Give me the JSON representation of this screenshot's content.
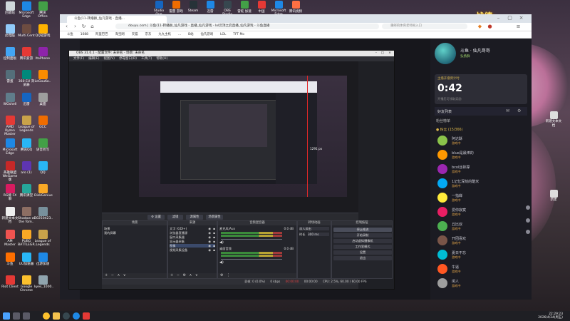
{
  "desktop": {
    "left_icons": [
      {
        "label": "回收站",
        "color": "#cfd8dc"
      },
      {
        "label": "Microsoft Edge",
        "color": "#1e88e5"
      },
      {
        "label": "腾讯 Office",
        "color": "#43a047"
      },
      {
        "label": "此电脑",
        "color": "#90caf9"
      },
      {
        "label": "Multi.Cent",
        "color": "#6d4c41"
      },
      {
        "label": "QQ轻游戏",
        "color": "#ffb300"
      },
      {
        "label": "控制面板",
        "color": "#42a5f5"
      },
      {
        "label": "腾讯爱游",
        "color": "#e53935"
      },
      {
        "label": "ItoPhone",
        "color": "#8e24aa"
      },
      {
        "label": "雷蛋",
        "color": "#546e7a"
      },
      {
        "label": "360 EU 浏览器",
        "color": "#00897b"
      },
      {
        "label": "LeGouKo..",
        "color": "#fb8c00"
      },
      {
        "label": "WGshell",
        "color": "#607d8b"
      },
      {
        "label": "迅雷",
        "color": "#1565c0"
      },
      {
        "label": "桌面",
        "color": "#9e9e9e"
      },
      {
        "label": "AMD Ryzen Master",
        "color": "#e53935"
      },
      {
        "label": "League of Legends",
        "color": "#c9a24a"
      },
      {
        "label": "GCC",
        "color": "#ef6c00"
      },
      {
        "label": "Microsoft Edge",
        "color": "#1e88e5"
      },
      {
        "label": "腾讯QQ",
        "color": "#29b6f6"
      },
      {
        "label": "语音听写",
        "color": "#43a047"
      },
      {
        "label": "英雄联盟 WeGame版",
        "color": "#c62828"
      },
      {
        "label": "aro (1)",
        "color": "#5e35b1"
      },
      {
        "label": "QQ",
        "color": "#29b6f6"
      },
      {
        "label": "RG能 FX 聊",
        "color": "#d81b60"
      },
      {
        "label": "腾讯课堂",
        "color": "#26a69a"
      },
      {
        "label": "DiskGenius",
        "color": "#f9a825"
      },
      {
        "label": "新建文本文档",
        "color": "#eeeeee"
      },
      {
        "label": "Shadow of the Tom..",
        "color": "#8d6e63"
      },
      {
        "label": "20250423..",
        "color": "#78909c"
      },
      {
        "label": "AM Master",
        "color": "#ef5350"
      },
      {
        "label": "PUBG BATTLEGR..",
        "color": "#f9a825"
      },
      {
        "label": "League of Legends",
        "color": "#c9a24a"
      },
      {
        "label": "斗鱼",
        "color": "#ff6f00"
      },
      {
        "label": "UU加速器",
        "color": "#29b6f6"
      },
      {
        "label": "迅游加速",
        "color": "#1e88e5"
      },
      {
        "label": "Riot Client",
        "color": "#e53935"
      },
      {
        "label": "Google Chrome",
        "color": "#fbc02d"
      },
      {
        "label": "kyes_1000..",
        "color": "#90a4ae"
      }
    ],
    "top_icons": [
      {
        "label": "Studio One",
        "color": "#1565c0"
      },
      {
        "label": "雷霆 游戏",
        "color": "#ef6c00"
      },
      {
        "label": "Steam",
        "color": "#263238"
      },
      {
        "label": "迅雷",
        "color": "#1e88e5"
      },
      {
        "label": "OBS Studio",
        "color": "#37474f"
      },
      {
        "label": "雷蛇 加速",
        "color": "#43a047"
      },
      {
        "label": "中国",
        "color": "#e53935"
      },
      {
        "label": "Microsoft Edge",
        "color": "#1e88e5"
      },
      {
        "label": "腾讯视频",
        "color": "#ff7043"
      }
    ],
    "watermark": "战绩:",
    "right_icons": [
      {
        "label": "新建文本文档"
      },
      {
        "label": "新建"
      }
    ]
  },
  "browser": {
    "tab_title": "斗鱼(11-转播群_仙凡游戏 - 直播...",
    "address": "douyu.com | 斗鱼(11-转播群_仙凡游戏 - 直播_仙凡游戏 - lol云顶之弈直播_仙凡游戏 - 斗鱼直播",
    "search_placeholder": "重邮的体育老师闹入口",
    "bookmarks": [
      "斗鱼",
      "1688",
      "阿里巴巴",
      "淘宝网",
      "天猫",
      "京东",
      "九九主机",
      "...",
      "B站",
      "仙凡游戏",
      "LOL",
      "TFT Mo"
    ]
  },
  "stream_page": {
    "streamer_name": "斗鱼 · 仙凡哥哥",
    "room_tag": "弘扬群",
    "countdown_label": "主播开播倒计时",
    "countdown": "0:42",
    "countdown_sub": "开播后可领取奖励",
    "fans_title": "好友列表",
    "fans_section": "粉丝榜单",
    "fans_group": "● 粉丝 (15/366)",
    "fans": [
      {
        "name": "阿达酥",
        "sub": "游戏中",
        "color": "#8bc34a"
      },
      {
        "name": "blue是最棒的",
        "sub": "游戏中",
        "color": "#ff9800"
      },
      {
        "name": "bcol丝袜撑",
        "sub": "游戏中",
        "color": "#9c27b0"
      },
      {
        "name": "1记忆深刻的酷米",
        "sub": "游戏中",
        "color": "#03a9f4"
      },
      {
        "name": "一指蝉",
        "sub": "游戏中",
        "color": "#ffeb3b"
      },
      {
        "name": "爱你寂寞",
        "sub": "游戏中",
        "color": "#e91e63"
      },
      {
        "name": "丘比叔",
        "sub": "游戏中",
        "color": "#4caf50"
      },
      {
        "name": "开团喜欢",
        "sub": "游戏中",
        "color": "#795548"
      },
      {
        "name": "夏日不忘",
        "sub": "游戏中",
        "color": "#00bcd4"
      },
      {
        "name": "牛逼",
        "sub": "游戏中",
        "color": "#ff5722"
      },
      {
        "name": "闲人",
        "sub": "游戏中",
        "color": "#9e9e9e"
      }
    ]
  },
  "obs": {
    "title": "OBS 31.0.1 - 配置文件: 未命名 - 场景: 未命名",
    "menu": [
      "文件(F)",
      "编辑(E)",
      "视图(V)",
      "停靠窗口(D)",
      "工具(T)",
      "帮助(H)"
    ],
    "mode_bar": {
      "edit_label": "⚙ 设置",
      "filter_label": "滤镜",
      "source_label": "源属性",
      "scene_label": "场景属性"
    },
    "scenes": {
      "header": "场景",
      "items": [
        "场景",
        "我的屏幕"
      ]
    },
    "sources": {
      "header": "来源",
      "items": [
        "文字 (GDI+)",
        "浏览器直播源",
        "窗口采集器",
        "显示器采集",
        "图像",
        "视频采集设备"
      ]
    },
    "mixer": {
      "header": "音频混音器",
      "channels": [
        {
          "name": "麦克风/Aux",
          "db": "0.0 dB"
        },
        {
          "name": "桌面音频",
          "db": "0.0 dB"
        }
      ]
    },
    "transitions": {
      "header": "转场动画",
      "type": "淡入淡出",
      "duration_label": "时长",
      "duration": "300 ms"
    },
    "controls": {
      "header": "控制按钮",
      "buttons": [
        "停止推流",
        "开始录制",
        "启动虚拟摄像机",
        "工作室模式",
        "设置",
        "退出"
      ]
    },
    "status": {
      "dropped": "丢帧: 0 (0.0%)",
      "bitrate": "0 kbps",
      "time": "00:00:00",
      "rec": "00:00:00",
      "cpu": "CPU: 2.5%, 60.00 / 60.00 FPS"
    },
    "nested_note": "1291 px"
  },
  "taskbar": {
    "time": "22:29:23",
    "date": "2026/4/24(周五)"
  }
}
